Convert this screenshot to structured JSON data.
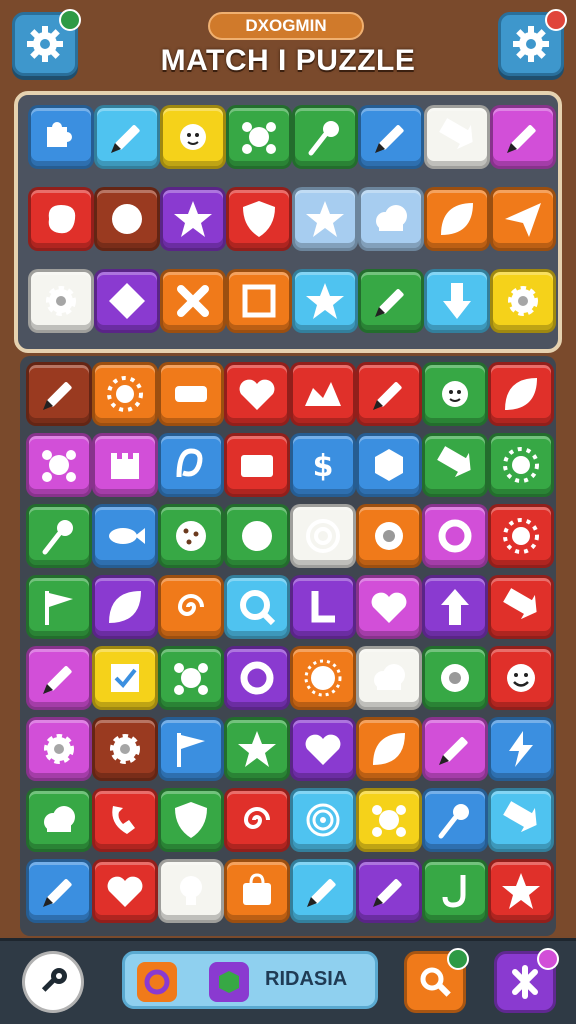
{
  "header": {
    "chip_label": "DXOGMIN",
    "title": "MATCH I PUZZLE",
    "left_button_icon": "gear-icon",
    "right_button_icon": "gear-icon",
    "left_badge_color": "#2e9a45",
    "right_badge_color": "#e0453a"
  },
  "bottom_bar": {
    "label": "RIDASIA",
    "left_icon": "key-icon",
    "right_icons": [
      "magnifier-icon",
      "cross-icon"
    ]
  },
  "colors": {
    "blue": "#3b8fe0",
    "cyan": "#4fc3f0",
    "yellow": "#f5d21a",
    "green": "#37a845",
    "red": "#e0302a",
    "orange": "#f07a1a",
    "purple": "#8a3ad0",
    "magenta": "#d24fd8",
    "white": "#f5f5f0",
    "brown": "#9a3a20",
    "lightblue": "#a7cdf0"
  },
  "board_top": [
    [
      "blue:puzzle-icon",
      "cyan:pencil-icon",
      "yellow:sun-face-icon",
      "green:splat-icon",
      "green:pin-icon",
      "blue:pencil-icon",
      "white:arrow-icon",
      "magenta:pencil-icon"
    ],
    [
      "red:blob-icon",
      "brown:ball-icon",
      "purple:star-icon",
      "red:shield-icon",
      "lightblue:star-icon",
      "lightblue:cloud-icon",
      "orange:leaf-icon",
      "orange:plane-icon"
    ],
    [
      "white:gear-icon",
      "purple:diamond-icon",
      "orange:cross-icon",
      "orange:frame-icon",
      "cyan:star-icon",
      "green:pencil-icon",
      "cyan:arrow-down-icon",
      "yellow:gear-icon"
    ]
  ],
  "board_main": [
    [
      "brown:pencil-icon",
      "orange:sun-icon",
      "orange:note-icon",
      "red:heart-icon",
      "red:hat-icon",
      "red:pencil-icon",
      "green:sun-face-icon",
      "red:leaf-icon"
    ],
    [
      "magenta:splat-icon",
      "magenta:castle-icon",
      "blue:loop-icon",
      "red:folder-icon",
      "blue:dollar-icon",
      "blue:cube-icon",
      "green:arrow-icon",
      "green:sun-icon"
    ],
    [
      "green:pin-icon",
      "blue:fish-icon",
      "green:cookie-icon",
      "green:ball-icon",
      "white:target-icon",
      "orange:eye-icon",
      "magenta:ring-icon",
      "red:sun-icon"
    ],
    [
      "green:flag-icon",
      "purple:leaf-icon",
      "orange:swirl-icon",
      "cyan:q-icon",
      "purple:l-icon",
      "magenta:heart-icon",
      "purple:up-arrow-icon",
      "red:arrow-icon"
    ],
    [
      "magenta:pencil-icon",
      "yellow:check-icon",
      "green:splat-icon",
      "purple:ring-icon",
      "orange:badge-icon",
      "white:cloud-icon",
      "green:eye-icon",
      "red:smile-icon"
    ],
    [
      "magenta:gear-icon",
      "brown:gear-icon",
      "blue:flag-icon",
      "green:star-icon",
      "purple:heart-icon",
      "orange:leaf-icon",
      "magenta:pencil-icon",
      "blue:bolt-icon"
    ],
    [
      "green:cloud-icon",
      "red:phone-icon",
      "green:shield-icon",
      "red:swirl-icon",
      "cyan:spiral-icon",
      "yellow:splat-icon",
      "blue:pin-icon",
      "cyan:arrow-icon"
    ],
    [
      "blue:pencil-icon",
      "red:heart-icon",
      "white:bulb-icon",
      "orange:bag-icon",
      "cyan:pencil-icon",
      "purple:pencil-icon",
      "green:hook-icon",
      "red:star-icon"
    ]
  ]
}
